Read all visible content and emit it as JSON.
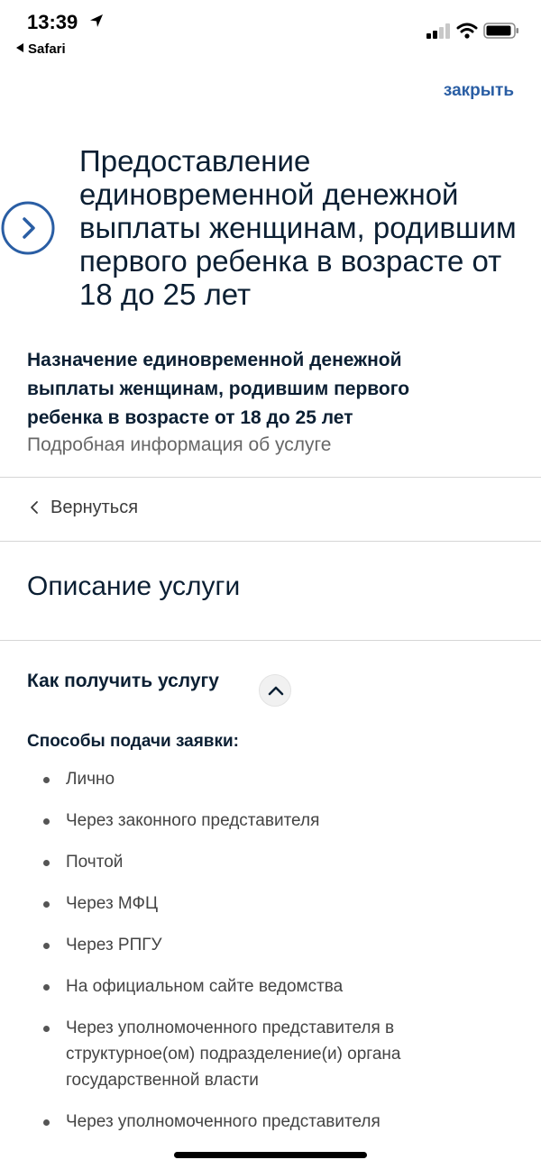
{
  "status_bar": {
    "time": "13:39",
    "back_app": "Safari"
  },
  "header": {
    "close_label": "закрыть",
    "title_lines": [
      "Предоставление",
      "единовременной денежной",
      "выплаты женщинам, родившим",
      "первого ребенка в возрасте от",
      "18 до 25 лет"
    ]
  },
  "service": {
    "subtitle_lines": [
      "Назначение единовременной денежной",
      "выплаты женщинам, родившим первого",
      "ребенка в возрасте от 18 до 25 лет"
    ],
    "more_info": "Подробная информация об услуге"
  },
  "nav": {
    "back_label": "Вернуться"
  },
  "description": {
    "title": "Описание услуги"
  },
  "how_to": {
    "title": "Как получить услугу",
    "ways_title": "Способы подачи заявки:",
    "ways": [
      "Лично",
      "Через законного представителя",
      "Почтой",
      "Через МФЦ",
      "Через РПГУ",
      "На официальном сайте ведомства",
      "Через уполномоченного представителя в структурное(ом) подразделение(и) органа государственной власти",
      "Через уполномоченного представителя"
    ]
  },
  "colors": {
    "accent": "#2a5ea4",
    "text": "#0b1f33",
    "muted": "#666666"
  },
  "icons": {
    "location": "location-arrow-icon",
    "signal": "signal-icon",
    "wifi": "wifi-icon",
    "battery": "battery-icon",
    "header_arrow": "circle-chevron-right-icon",
    "back": "chevron-left-icon",
    "expand": "chevron-up-icon"
  }
}
